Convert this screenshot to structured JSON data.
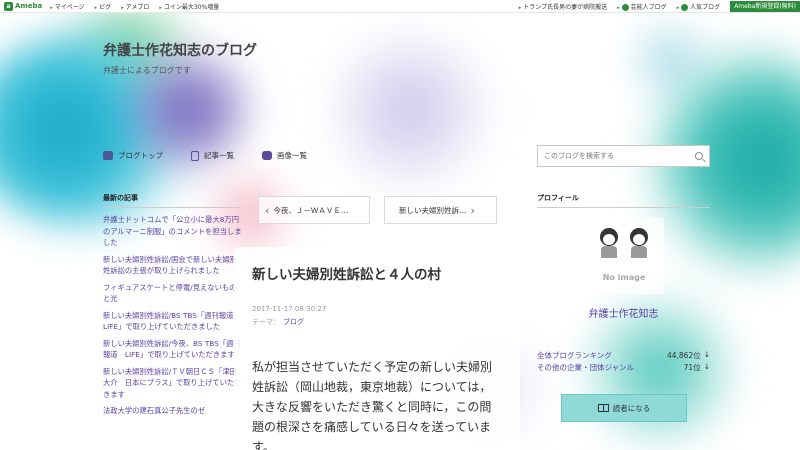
{
  "topbar": {
    "logo": "Ameba",
    "links": [
      "マイページ",
      "ピグ",
      "アメブロ",
      "コイン最大30%増量"
    ],
    "news": "トランプ氏長男の妻が病院搬送",
    "celeb": "芸能人ブログ",
    "popular": "人気ブログ",
    "register": "Ameba新規登録(無料)"
  },
  "header": {
    "title": "弁護士作花知志のブログ",
    "subtitle": "弁護士によるブログです"
  },
  "nav": {
    "blog_top": "ブログトップ",
    "articles": "記事一覧",
    "images": "画像一覧"
  },
  "search": {
    "placeholder": "このブログを検索する"
  },
  "recent": {
    "heading": "最新の記事",
    "items": [
      "弁護士ドットコムで「公立小に最大8万円のアルマーニ制服」のコメントを担当しました",
      "新しい夫婦別姓訴訟/国会で新しい夫婦別姓訴訟の主張が取り上げられました",
      "フィギュアスケートと停電/見えないものと光",
      "新しい夫婦別姓訴訟/BS TBS「週刊報道　LIFE」で取り上げていただきました",
      "新しい夫婦別姓訴訟/今夜、BS TBS「週刊報道　LIFE」で取り上げていただきます",
      "新しい夫婦別姓訴訟/ＴＶ朝日ＣＳ「津田大介　日本にプラス」で取り上げていただきます",
      "法政大学の建石真公子先生のゼ"
    ]
  },
  "article_nav": {
    "prev": "今夜、Ｊ－ＷＡＶＥ…",
    "next": "新しい夫婦別姓訴…"
  },
  "article": {
    "title": "新しい夫婦別姓訴訟と４人の村",
    "date": "2017-11-17 08:30:27",
    "theme_label": "テーマ：",
    "theme": "ブログ",
    "body": "私が担当させていただく予定の新しい夫婦別姓訴訟（岡山地裁，東京地裁）については，大きな反響をいただき驚くと同時に，この問題の根深さを痛感している日々を送っています。"
  },
  "profile": {
    "heading": "プロフィール",
    "no_image": "No image",
    "name": "弁護士作花知志",
    "rank1_label": "全体ブログランキング",
    "rank1_value": "44,862位",
    "rank2_label": "その他の企業・団体ジャンル",
    "rank2_value": "71位",
    "arrow": "↓",
    "reader_button": "読者になる"
  }
}
